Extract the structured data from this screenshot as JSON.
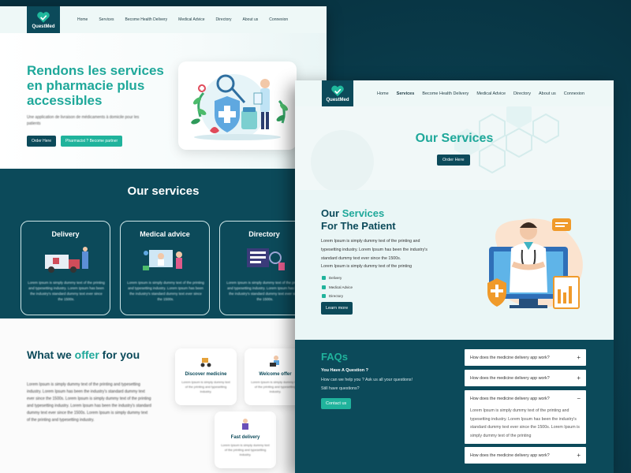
{
  "left_page": {
    "logo_text": "QuestMed",
    "nav": [
      "Home",
      "Services",
      "Become Health Delivery",
      "Medical Advice",
      "Directory",
      "About us",
      "Connexion"
    ],
    "hero": {
      "title": "Rendons les services en pharmacie plus accessibles",
      "subtitle": "Une application de livraison de médicaments à domicile pour les patients",
      "order_button": "Order Here",
      "pharmacist_button": "Pharmacist ? Become partner"
    },
    "services": {
      "heading": "Our services",
      "cards": [
        {
          "title": "Delivery",
          "desc": "Lorem Ipsum is simply dummy text of the printing and typesetting industry. Lorem Ipsum has been the industry's standard dummy text ever since the 1500s."
        },
        {
          "title": "Medical advice",
          "desc": "Lorem Ipsum is simply dummy text of the printing and typesetting industry. Lorem Ipsum has been the industry's standard dummy text ever since the 1500s."
        },
        {
          "title": "Directory",
          "desc": "Lorem Ipsum is simply dummy text of the printing and typesetting industry. Lorem Ipsum has been the industry's standard dummy text ever since the 1500s."
        }
      ]
    },
    "offer": {
      "heading_before": "What we ",
      "heading_highlight": "offer",
      "heading_after": " for you",
      "text": "Lorem Ipsum is simply dummy text of the printing and typesetting industry. Lorem Ipsum has been the industry's standard dummy text ever since the 1500s. Lorem Ipsum is simply dummy text of the printing and typesetting industry. Lorem Ipsum has been the industry's standard dummy text ever since the 1500s. Lorem Ipsum is simply dummy text of the printing and typesetting industry.",
      "cards": [
        {
          "title": "Discover medicine",
          "desc": "Lorem Ipsum is simply dummy text of the printing and typesetting industry."
        },
        {
          "title": "Welcome offer",
          "desc": "Lorem Ipsum is simply dummy text of the printing and typesetting industry."
        },
        {
          "title": "Fast delivery",
          "desc": "Lorem Ipsum is simply dummy text of the printing and typesetting industry."
        }
      ]
    }
  },
  "right_page": {
    "logo_text": "QuestMed",
    "nav": [
      "Home",
      "Services",
      "Become Health Delivery",
      "Medical Advice",
      "Directory",
      "About us",
      "Connexion"
    ],
    "active_nav": "Services",
    "hero": {
      "title": "Our Services",
      "button": "Order Here"
    },
    "patient": {
      "heading_before": "Our ",
      "heading_highlight": "Services",
      "heading_line2": "For The Patient",
      "desc": "Lorem Ipsum is simply dummy text of the printing and typesetting industry. Lorem Ipsum has been the industry's standard dummy text ever since the 1500s.",
      "desc2": "Lorem Ipsum is simply dummy text of the printing",
      "checklist": [
        "Delivery",
        "Medical Advice",
        "Directory"
      ],
      "button": "Learn more"
    },
    "faq": {
      "heading": "FAQs",
      "question": "You Have A Question ?",
      "help": "How can we help you ? Ask us all your questions!",
      "still": "Still have questions?",
      "contact_button": "Contact us",
      "items": [
        {
          "question": "How does the  medicine delivery app work?",
          "sign": "+",
          "open": false
        },
        {
          "question": "How does the  medicine delivery app work?",
          "sign": "+",
          "open": false
        },
        {
          "question": "How does the  medicine delivery app work?",
          "sign": "−",
          "open": true,
          "answer": "Lorem Ipsum is simply dummy text of the printing and typesetting industry. Lorem Ipsum has been the industry's standard dummy text ever since the 1500s. Lorem Ipsum is simply dummy text of the printing"
        },
        {
          "question": "How does the  medicine delivery app work?",
          "sign": "+",
          "open": false
        }
      ]
    }
  },
  "colors": {
    "primary": "#0c4a5a",
    "accent": "#20b39c",
    "accent_text": "#1fa89a",
    "background": "#0a3a4a"
  }
}
